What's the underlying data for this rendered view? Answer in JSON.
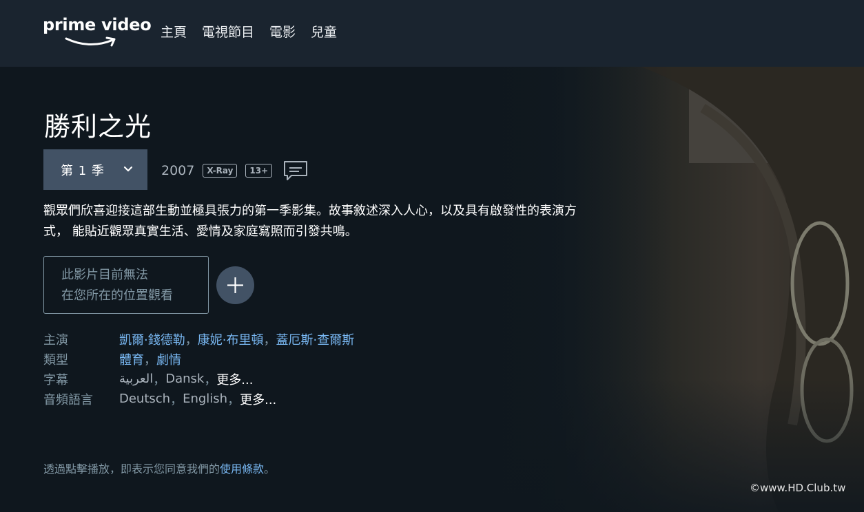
{
  "header": {
    "logo_text": "prime video",
    "nav": [
      {
        "label": "主頁"
      },
      {
        "label": "電視節目"
      },
      {
        "label": "電影"
      },
      {
        "label": "兒童"
      }
    ]
  },
  "show": {
    "title": "勝利之光",
    "season_label": "第 1 季",
    "year": "2007",
    "xray_badge": "X-Ray",
    "rating_badge": "13+",
    "synopsis_line1": "觀眾們欣喜迎接這部生動並極具張力的第一季影集。故事敘述深入人心，以及具有啟發性的表演方",
    "synopsis_line2": "式， 能貼近觀眾真實生活、愛情及家庭寫照而引發共鳴。"
  },
  "availability": {
    "line1": "此影片目前無法",
    "line2": "在您所在的位置觀看"
  },
  "details": {
    "cast_label": "主演",
    "cast": [
      "凱爾·錢德勒",
      "康妮·布里頓",
      "蓋厄斯·查爾斯"
    ],
    "genre_label": "類型",
    "genres": [
      "體育",
      "劇情"
    ],
    "subtitles_label": "字幕",
    "subtitles": [
      "العربية",
      "Dansk"
    ],
    "audio_label": "音頻語言",
    "audio": [
      "Deutsch",
      "English"
    ],
    "separator": "，",
    "more_label": "更多..."
  },
  "terms": {
    "prefix": "透過點擊播放，即表示您同意我們的",
    "link": "使用條款",
    "suffix": "。"
  },
  "watermark": "©www.HD.Club.tw",
  "colors": {
    "background": "#0f171e",
    "header": "#1a242f",
    "button": "#425265",
    "link": "#79b8f3",
    "muted": "#8197a4"
  }
}
